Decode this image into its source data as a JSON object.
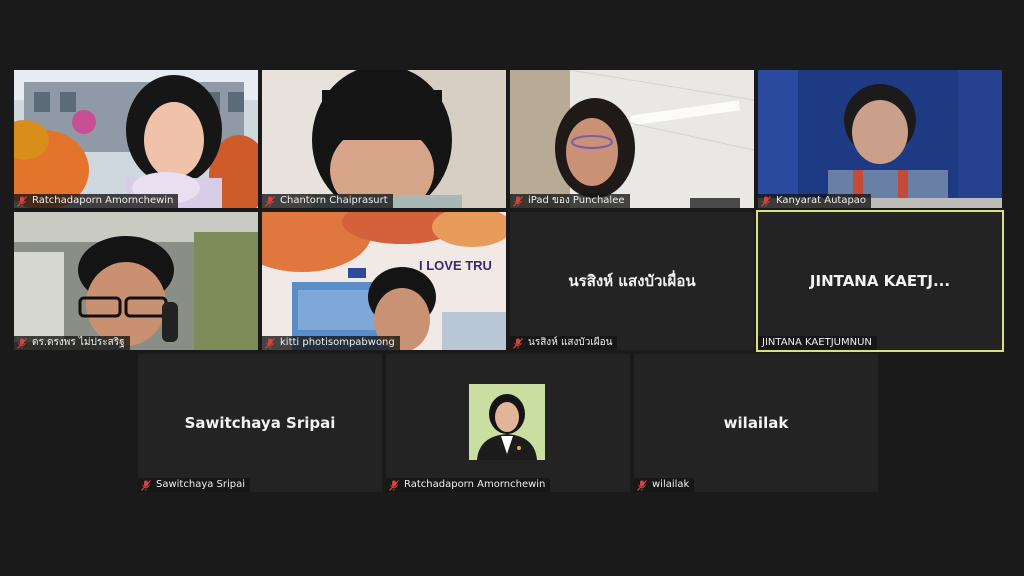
{
  "tiles": [
    {
      "name": "Ratchadaporn Amornchewin",
      "muted": true,
      "video": "building-flowers"
    },
    {
      "name": "Chantorn Chaiprasurt",
      "muted": true,
      "video": "face-closeup"
    },
    {
      "name": "iPad ของ Punchalee",
      "muted": true,
      "video": "office-ceiling"
    },
    {
      "name": "Kanyarat Autapao",
      "muted": true,
      "video": "blue-wall"
    },
    {
      "name": "ดร.ดรงพร ไม่ประสริฐ",
      "muted": true,
      "video": "man-phone"
    },
    {
      "name": "kitti photisompabwong",
      "muted": true,
      "video": "i-love-tru-background",
      "bg_text": "I LOVE TRU"
    },
    {
      "name": "นรสิงห์ แสงบัวเผื่อน",
      "display": "นรสิงห์ แสงบัวเผื่อน",
      "muted": true
    },
    {
      "name": "JINTANA KAETJUMNUN",
      "display": "JINTANA  KAETJ...",
      "muted": false,
      "active_speaker": true
    },
    {
      "name": "Sawitchaya Sripai",
      "display": "Sawitchaya Sripai",
      "muted": true
    },
    {
      "name": "Ratchadaporn Amornchewin",
      "muted": true,
      "video": "profile-photo"
    },
    {
      "name": "wilailak",
      "display": "wilailak",
      "muted": true
    }
  ],
  "colors": {
    "background": "#1a1a1a",
    "tile": "#232323",
    "active_border": "#d7e27a",
    "muted_icon": "#e0403a"
  },
  "icons": {
    "muted": "microphone-muted-icon"
  }
}
